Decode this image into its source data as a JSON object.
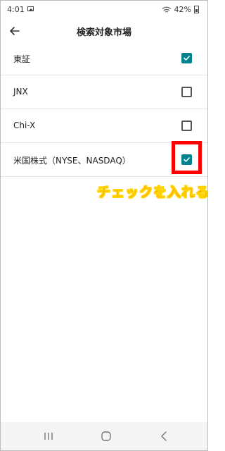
{
  "status_bar": {
    "time": "4:01",
    "battery": "42%",
    "icons": [
      "image-icon",
      "wifi-icon",
      "battery-icon"
    ]
  },
  "header": {
    "title": "検索対象市場",
    "back_icon": "arrow-back-icon"
  },
  "markets": [
    {
      "label": "東証",
      "checked": true
    },
    {
      "label": "JNX",
      "checked": false
    },
    {
      "label": "Chi-X",
      "checked": false
    },
    {
      "label": "米国株式（NYSE、NASDAQ）",
      "checked": true
    }
  ],
  "annotation": {
    "text": "チェックを入れる",
    "color": "#ff1a1a",
    "outline_color": "#ffd400",
    "box_color": "#ff0000"
  },
  "nav_bar": {
    "icons": [
      "recents-icon",
      "home-icon",
      "back-icon"
    ]
  },
  "colors": {
    "accent": "#00838f",
    "divider": "#e3e3e3"
  }
}
